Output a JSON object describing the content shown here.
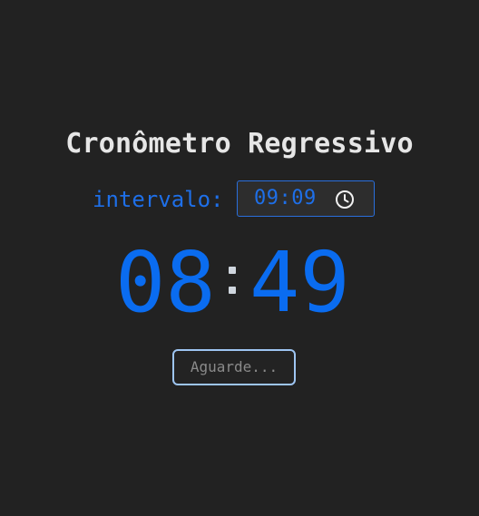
{
  "app": {
    "title": "Cronômetro Regressivo"
  },
  "interval": {
    "label": "intervalo:",
    "value": "09:09",
    "icon": "clock-icon"
  },
  "countdown": {
    "minutes": "08",
    "seconds": "49",
    "separator": ":"
  },
  "button": {
    "label": "Aguarde..."
  },
  "colors": {
    "background": "#222222",
    "accent": "#0a6cf0",
    "title": "#e6e6e6",
    "button_border": "#9ec5f2",
    "button_text": "#8a8a8a"
  }
}
